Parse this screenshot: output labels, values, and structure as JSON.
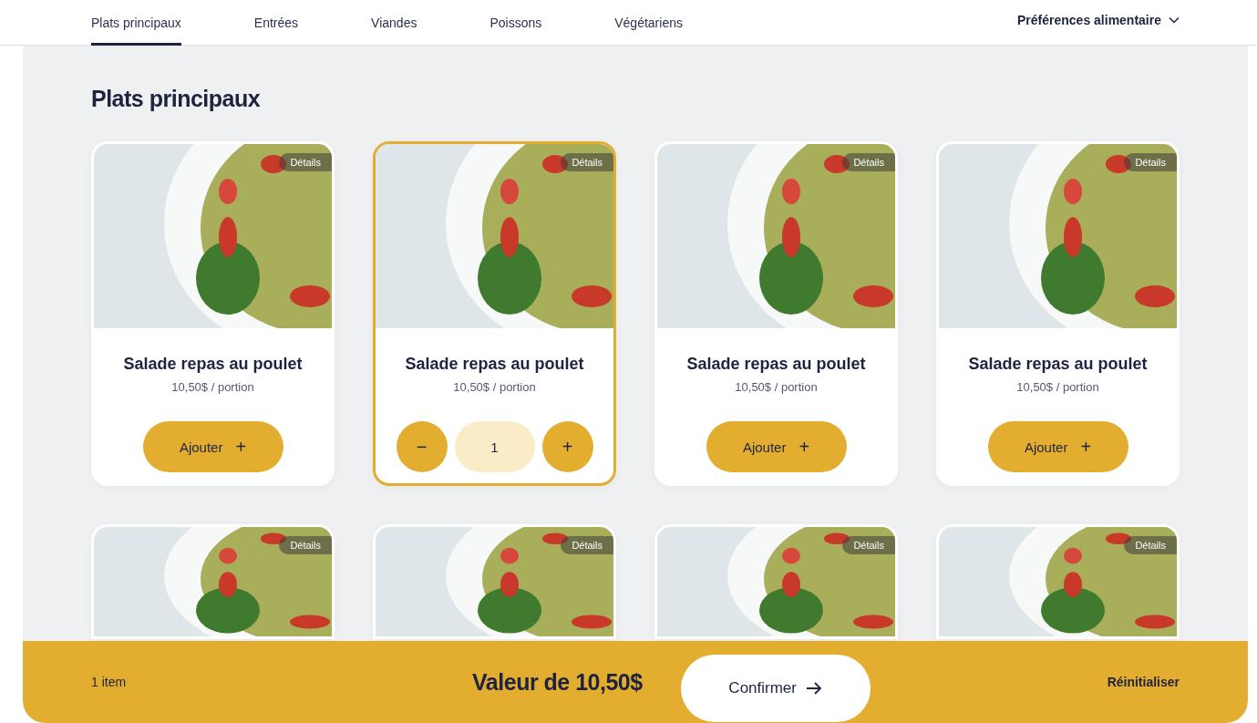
{
  "tabs": [
    {
      "label": "Plats principaux",
      "selected": true
    },
    {
      "label": "Entrées",
      "selected": false
    },
    {
      "label": "Viandes",
      "selected": false
    },
    {
      "label": "Poissons",
      "selected": false
    },
    {
      "label": "Végétariens",
      "selected": false
    }
  ],
  "preferences": {
    "label": "Préférences alimentaire"
  },
  "section": {
    "title": "Plats principaux"
  },
  "cards": [
    {
      "details": "Détails",
      "title": "Salade repas au poulet",
      "price": "10,50$ / portion",
      "selected": false,
      "add_label": "Ajouter",
      "plus": "+"
    },
    {
      "details": "Détails",
      "title": "Salade repas au poulet",
      "price": "10,50$ / portion",
      "selected": true,
      "minus": "−",
      "quantity": "1",
      "plus": "+"
    },
    {
      "details": "Détails",
      "title": "Salade repas au poulet",
      "price": "10,50$ / portion",
      "selected": false,
      "add_label": "Ajouter",
      "plus": "+"
    },
    {
      "details": "Détails",
      "title": "Salade repas au poulet",
      "price": "10,50$ / portion",
      "selected": false,
      "add_label": "Ajouter",
      "plus": "+"
    },
    {
      "details": "Détails",
      "selected": false
    },
    {
      "details": "Détails",
      "selected": false
    },
    {
      "details": "Détails",
      "selected": false
    },
    {
      "details": "Détails",
      "selected": false
    }
  ],
  "cart": {
    "count": "1 item",
    "total": "Valeur de 10,50$",
    "confirm": "Confirmer",
    "reset": "Réinitialiser"
  }
}
